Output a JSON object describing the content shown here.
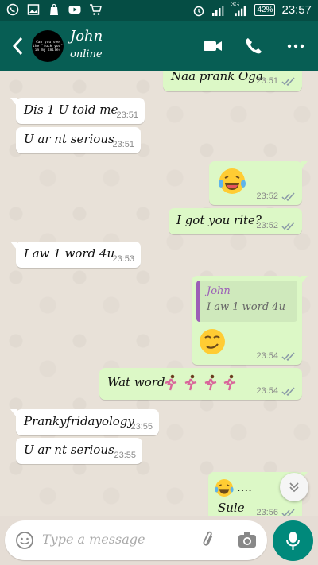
{
  "status_bar": {
    "left_icons": [
      "whatsapp-icon",
      "gallery-icon",
      "shop-icon",
      "youtube-icon",
      "cart-icon"
    ],
    "right_icons": [
      "alarm-icon",
      "signal-icon",
      "signal-3g-icon"
    ],
    "network": "3G",
    "battery": "42%",
    "time": "23:57"
  },
  "header": {
    "contact_name": "John",
    "contact_status": "online",
    "avatar_text": "Can you see the \"fuck you\" in my smile?",
    "icons": [
      "back-arrow-icon",
      "video-call-icon",
      "phone-call-icon",
      "more-options-icon"
    ]
  },
  "messages": [
    {
      "dir": "out",
      "text": "Naa prank Oga",
      "time": "23:51"
    },
    {
      "dir": "in",
      "text": "Dis 1 U told me",
      "time": "23:51"
    },
    {
      "dir": "in",
      "text": "U ar nt serious",
      "time": "23:51"
    },
    {
      "dir": "out",
      "emoji": "laughing-tears-emoji",
      "time": "23:52"
    },
    {
      "dir": "out",
      "text": "I got you rite?",
      "time": "23:52"
    },
    {
      "dir": "in",
      "text": "I aw 1 word 4u",
      "time": "23:53"
    },
    {
      "dir": "out",
      "quote_name": "John",
      "quote_text": "I aw 1 word 4u",
      "emoji": "smirk-emoji",
      "time": "23:54"
    },
    {
      "dir": "out",
      "text": "Wat word",
      "emoji": "running-woman-emoji x4",
      "time": "23:54"
    },
    {
      "dir": "in",
      "text": "Prankyfridayology",
      "time": "23:55"
    },
    {
      "dir": "in",
      "text": "U ar nt serious",
      "time": "23:55"
    },
    {
      "dir": "out",
      "text": "....",
      "text2": "Sule",
      "emoji": "laughing-tears-emoji",
      "time": "23:56"
    }
  ],
  "input": {
    "placeholder": "Type a message"
  },
  "colors": {
    "header": "#075e54",
    "status_bar": "#054d44",
    "outgoing": "#dcf8c6",
    "incoming": "#ffffff",
    "mic": "#00897b",
    "quote_accent": "#9c5fb7"
  }
}
